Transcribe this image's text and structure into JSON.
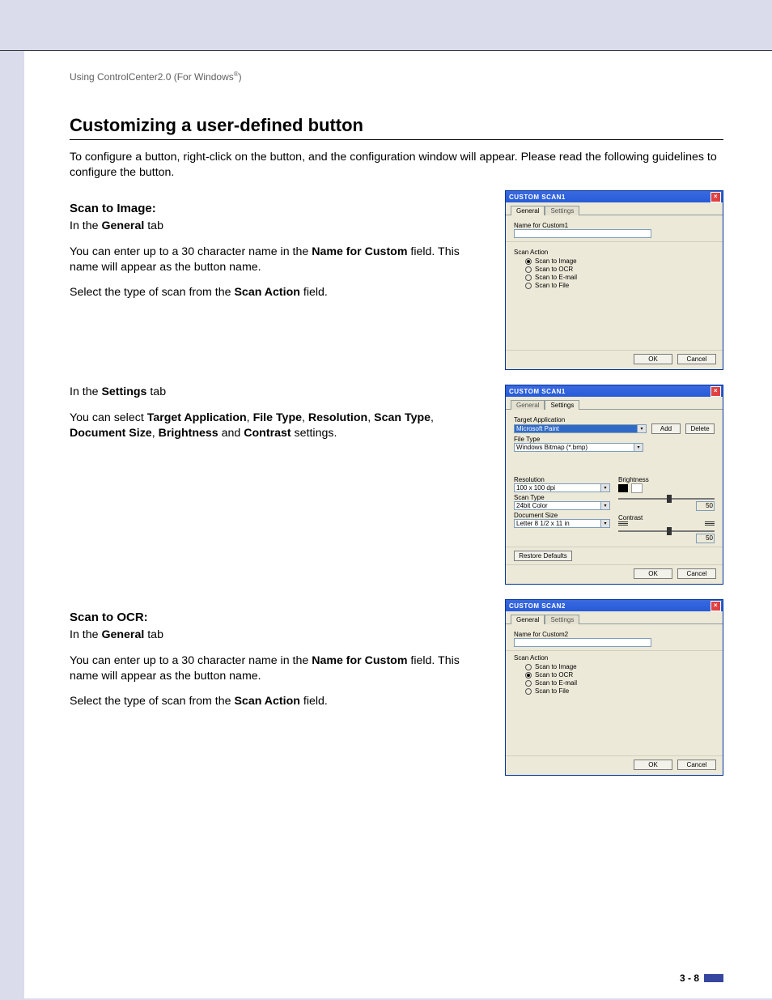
{
  "doc": {
    "running_head": "Using ControlCenter2.0 (For Windows",
    "running_head_sup": "®",
    "running_head_end": ")",
    "title": "Customizing a user-defined button",
    "intro": "To configure a button, right-click on the button, and the configuration window will appear. Please read the following guidelines to configure the button.",
    "section1_heading": "Scan to Image:",
    "section1_general_intro": "In the ",
    "section1_general_bold": "General",
    "section1_general_intro2": " tab",
    "section1_p1a": "You can enter up to a 30 character name in the ",
    "section1_p1b": "Name for Custom",
    "section1_p1c": " field. This name will appear as the button name.",
    "section1_p2a": "Select the type of scan from the ",
    "section1_p2b": "Scan Action",
    "section1_p2c": " field.",
    "section1_settings_intro": "In the ",
    "section1_settings_bold": "Settings",
    "section1_settings_intro2": " tab",
    "section1_settings_p_a": "You can select ",
    "section1_settings_p_b": "Target Application",
    "section1_settings_p_c": ", ",
    "section1_settings_p_d": "File Type",
    "section1_settings_p_e": ", ",
    "section1_settings_p_f": "Resolution",
    "section1_settings_p_g": ", ",
    "section1_settings_p_h": "Scan Type",
    "section1_settings_p_i": ", ",
    "section1_settings_p_j": "Document Size",
    "section1_settings_p_k": ", ",
    "section1_settings_p_l": "Brightness",
    "section1_settings_p_m": " and ",
    "section1_settings_p_n": "Contrast",
    "section1_settings_p_o": " settings.",
    "section2_heading": "Scan to OCR:",
    "chapter_number": "3",
    "page_number": "3 - 8"
  },
  "dlg1": {
    "title": "CUSTOM SCAN1",
    "tab_general": "General",
    "tab_settings": "Settings",
    "name_label": "Name for Custom1",
    "name_value": "",
    "scan_action_legend": "Scan Action",
    "opt_image": "Scan to Image",
    "opt_ocr": "Scan to OCR",
    "opt_email": "Scan to E-mail",
    "opt_file": "Scan to File",
    "ok": "OK",
    "cancel": "Cancel"
  },
  "dlg2": {
    "title": "CUSTOM SCAN1",
    "tab_general": "General",
    "tab_settings": "Settings",
    "target_app_label": "Target Application",
    "target_app_value": "Microsoft Paint",
    "add_btn": "Add",
    "delete_btn": "Delete",
    "file_type_label": "File Type",
    "file_type_value": "Windows Bitmap (*.bmp)",
    "resolution_label": "Resolution",
    "resolution_value": "100 x 100 dpi",
    "scan_type_label": "Scan Type",
    "scan_type_value": "24bit Color",
    "doc_size_label": "Document Size",
    "doc_size_value": "Letter 8 1/2 x 11 in",
    "brightness_label": "Brightness",
    "brightness_value": "50",
    "contrast_label": "Contrast",
    "contrast_value": "50",
    "restore": "Restore Defaults",
    "ok": "OK",
    "cancel": "Cancel"
  },
  "dlg3": {
    "title": "CUSTOM SCAN2",
    "tab_general": "General",
    "tab_settings": "Settings",
    "name_label": "Name for Custom2",
    "name_value": "",
    "scan_action_legend": "Scan Action",
    "opt_image": "Scan to Image",
    "opt_ocr": "Scan to OCR",
    "opt_email": "Scan to E-mail",
    "opt_file": "Scan to File",
    "ok": "OK",
    "cancel": "Cancel"
  }
}
